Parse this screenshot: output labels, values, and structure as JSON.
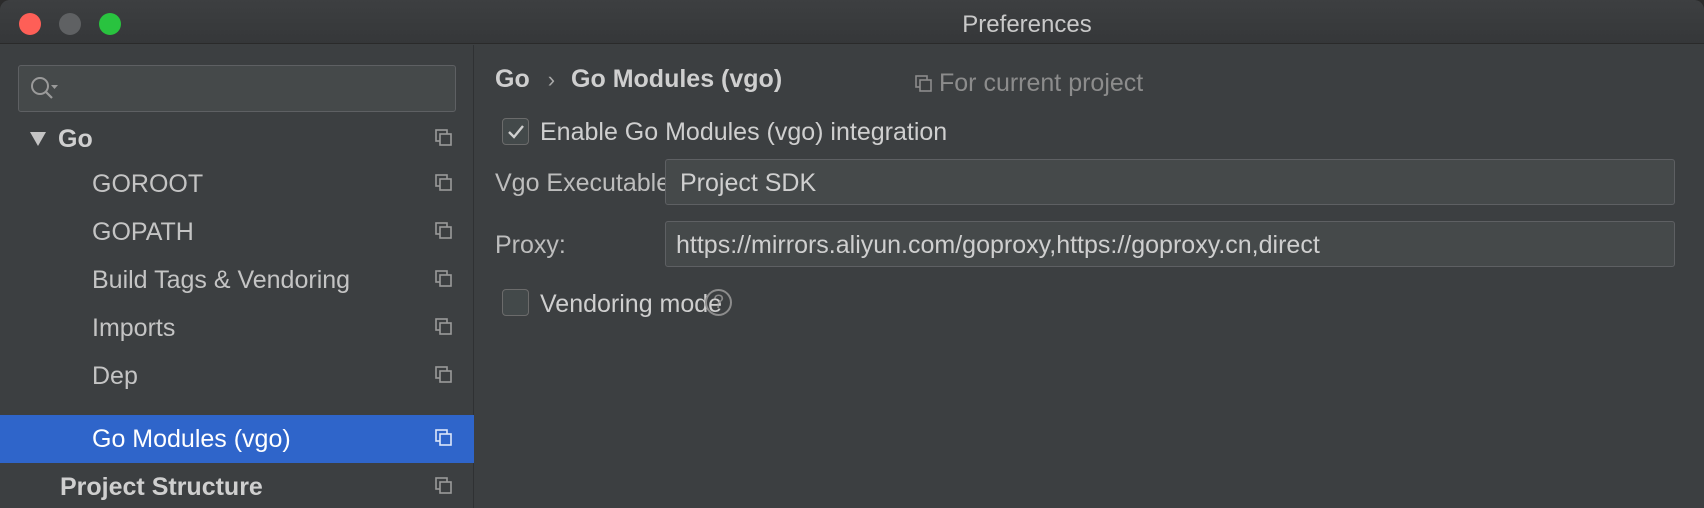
{
  "window": {
    "title": "Preferences"
  },
  "sidebar": {
    "search": {
      "placeholder": "",
      "value": ""
    },
    "items": [
      {
        "label": "Go",
        "level": 0,
        "expanded": true,
        "selected": false
      },
      {
        "label": "GOROOT",
        "level": 1,
        "selected": false
      },
      {
        "label": "GOPATH",
        "level": 1,
        "selected": false
      },
      {
        "label": "Build Tags & Vendoring",
        "level": 1,
        "selected": false
      },
      {
        "label": "Imports",
        "level": 1,
        "selected": false
      },
      {
        "label": "Dep",
        "level": 1,
        "selected": false
      },
      {
        "label": "Go Modules (vgo)",
        "level": 1,
        "selected": true
      },
      {
        "label": "Project Structure",
        "level": 0,
        "selected": false
      }
    ]
  },
  "content": {
    "breadcrumb": {
      "parent": "Go",
      "separator": "›",
      "current": "Go Modules (vgo)"
    },
    "scope_label": "For current project",
    "enable_modules": {
      "label": "Enable Go Modules (vgo) integration",
      "checked": true
    },
    "vgo_executable": {
      "label": "Vgo Executable:",
      "value": "Project SDK"
    },
    "proxy": {
      "label": "Proxy:",
      "value": "https://mirrors.aliyun.com/goproxy,https://goproxy.cn,direct"
    },
    "vendoring_mode": {
      "label": "Vendoring mode",
      "checked": false,
      "help": "?"
    }
  },
  "colors": {
    "selection": "#2f65ca",
    "background": "#3c3f41",
    "close": "#fe5f57",
    "maximize": "#29c33f"
  }
}
